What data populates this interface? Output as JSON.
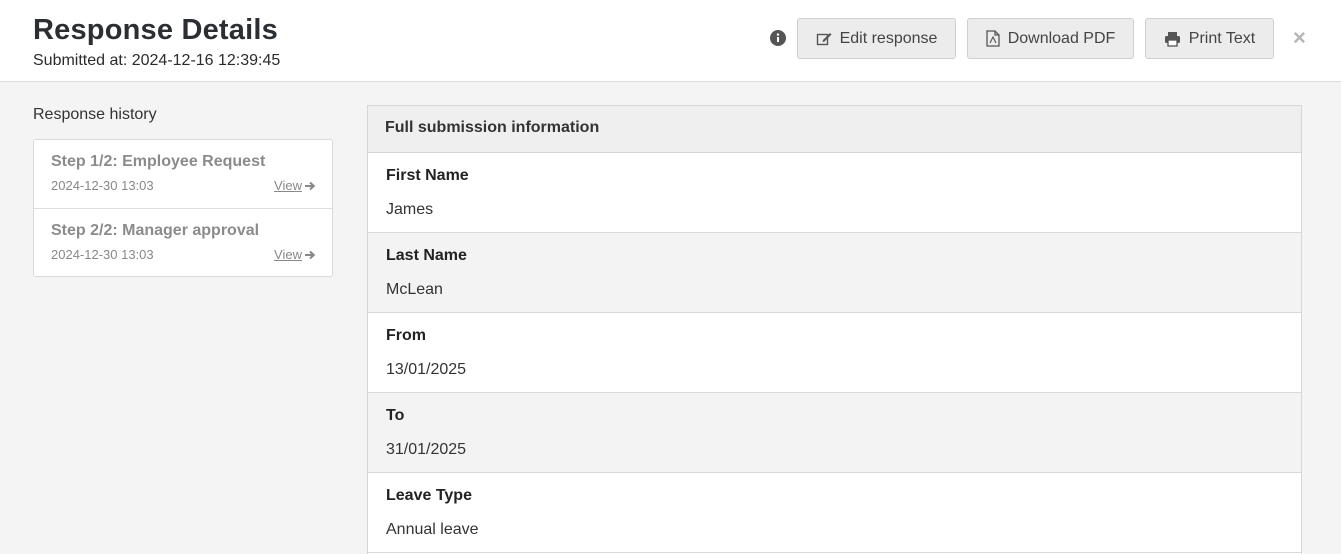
{
  "header": {
    "title": "Response Details",
    "submitted": "Submitted at: 2024-12-16 12:39:45",
    "edit_label": "Edit response",
    "pdf_label": "Download PDF",
    "print_label": "Print Text",
    "close": "×"
  },
  "history": {
    "label": "Response history",
    "items": [
      {
        "step": "Step 1/2: Employee Request",
        "date": "2024-12-30 13:03",
        "view": "View"
      },
      {
        "step": "Step 2/2: Manager approval",
        "date": "2024-12-30 13:03",
        "view": "View"
      }
    ]
  },
  "submission": {
    "heading": "Full submission information",
    "fields": [
      {
        "label": "First Name",
        "value": "James"
      },
      {
        "label": "Last Name",
        "value": "McLean"
      },
      {
        "label": "From",
        "value": "13/01/2025"
      },
      {
        "label": "To",
        "value": "31/01/2025"
      },
      {
        "label": "Leave Type",
        "value": "Annual leave"
      }
    ]
  },
  "icons": [
    "info-icon",
    "edit-icon",
    "pdf-icon",
    "print-icon",
    "close-icon",
    "arrow-right-icon"
  ]
}
